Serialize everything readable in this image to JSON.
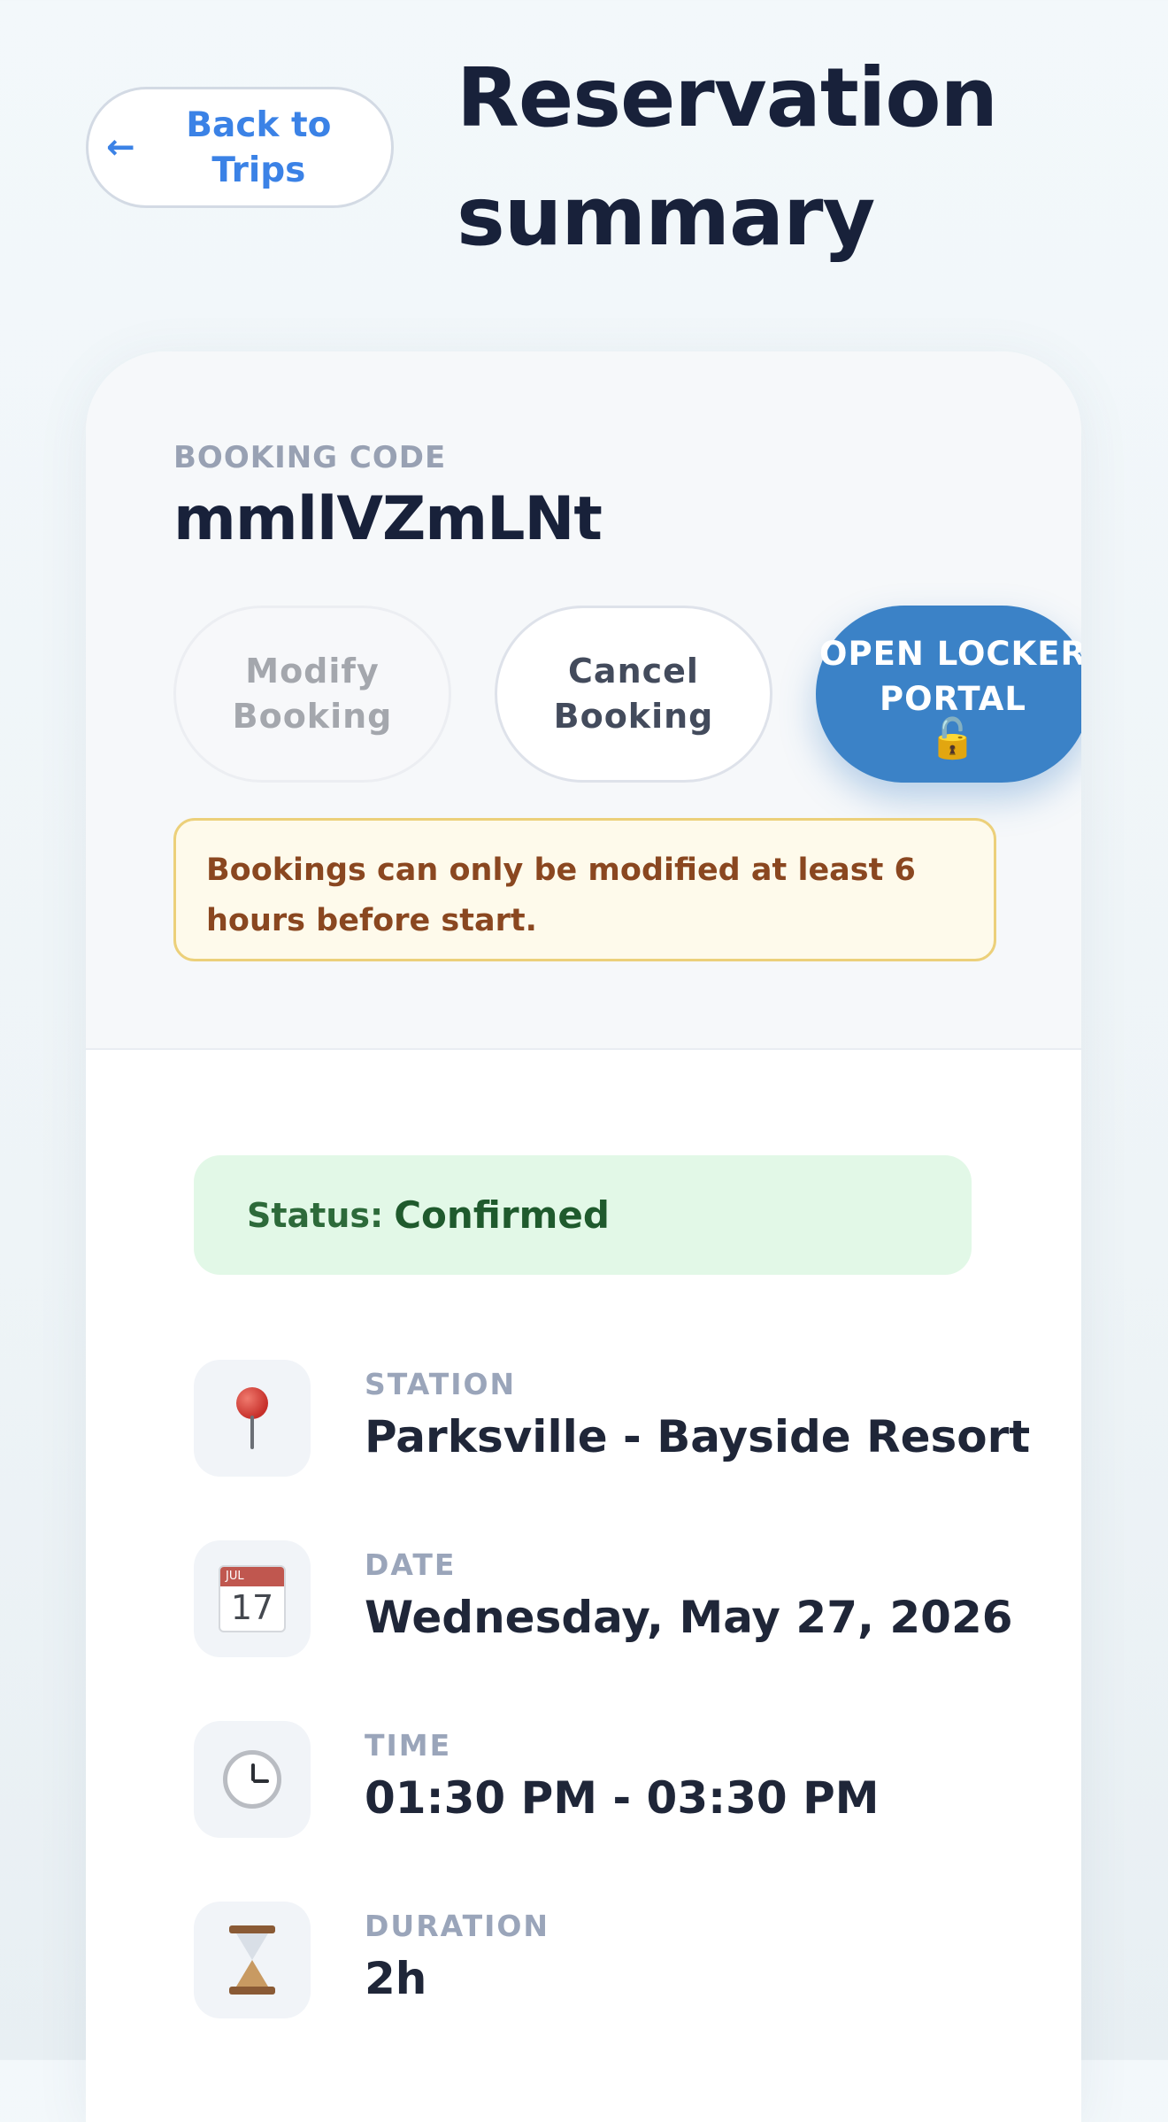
{
  "header": {
    "back_arrow": "←",
    "back_label": "Back to Trips",
    "title": "Reservation summary"
  },
  "booking": {
    "code_label": "BOOKING CODE",
    "code": "mmllVZmLNt"
  },
  "actions": {
    "modify_label": "Modify Booking",
    "cancel_label": "Cancel Booking",
    "portal_label": "OPEN LOCKER PORTAL",
    "portal_icon": "lock-icon"
  },
  "notice": {
    "text": "Bookings can only be modified at least 6 hours before start."
  },
  "status": {
    "label": "Status:",
    "value": "Confirmed"
  },
  "details": [
    {
      "icon": "pin-icon",
      "label": "STATION",
      "value": "Parksville - Bayside Resort"
    },
    {
      "icon": "calendar-icon",
      "label": "DATE",
      "value": "Wednesday, May 27, 2026",
      "icon_month": "JUL",
      "icon_day": "17"
    },
    {
      "icon": "clock-icon",
      "label": "TIME",
      "value": "01:30 PM - 03:30 PM"
    },
    {
      "icon": "hourglass-icon",
      "label": "DURATION",
      "value": "2h"
    }
  ],
  "colors": {
    "accent": "#3b82c7",
    "link": "#3b82e6",
    "title": "#18213a",
    "status_bg": "#e2f8e7",
    "notice_bg": "#fefaeb",
    "notice_border": "#ecd07a"
  }
}
